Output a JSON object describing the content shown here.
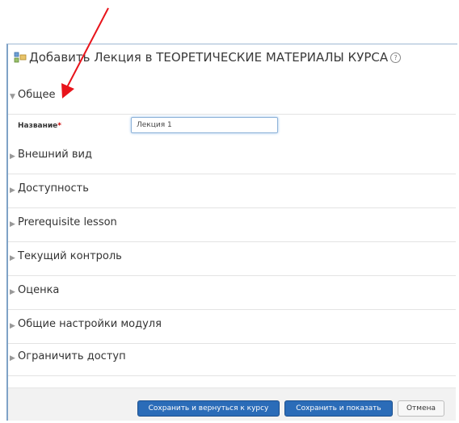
{
  "header": {
    "title": "Добавить Лекция в ТЕОРЕТИЧЕСКИЕ МАТЕРИАЛЫ КУРСА",
    "help_icon": "question-circle-icon",
    "module_icon": "module-icon"
  },
  "sections": [
    {
      "label": "Общее",
      "expanded": true
    },
    {
      "label": "Внешний вид",
      "expanded": false
    },
    {
      "label": "Доступность",
      "expanded": false
    },
    {
      "label": "Prerequisite lesson",
      "expanded": false
    },
    {
      "label": "Текущий контроль",
      "expanded": false
    },
    {
      "label": "Оценка",
      "expanded": false
    },
    {
      "label": "Общие настройки модуля",
      "expanded": false
    },
    {
      "label": "Ограничить доступ",
      "expanded": false
    }
  ],
  "name_field": {
    "label": "Название",
    "required_marker": "*",
    "value": "Лекция 1"
  },
  "buttons": {
    "save_return": "Сохранить и вернуться к курсу",
    "save_show": "Сохранить и показать",
    "cancel": "Отмена"
  },
  "annotation": {
    "arrow_color": "#e8141b"
  },
  "colors": {
    "primary_button": "#2b6cb8",
    "frame_border": "#7fa3c7"
  }
}
